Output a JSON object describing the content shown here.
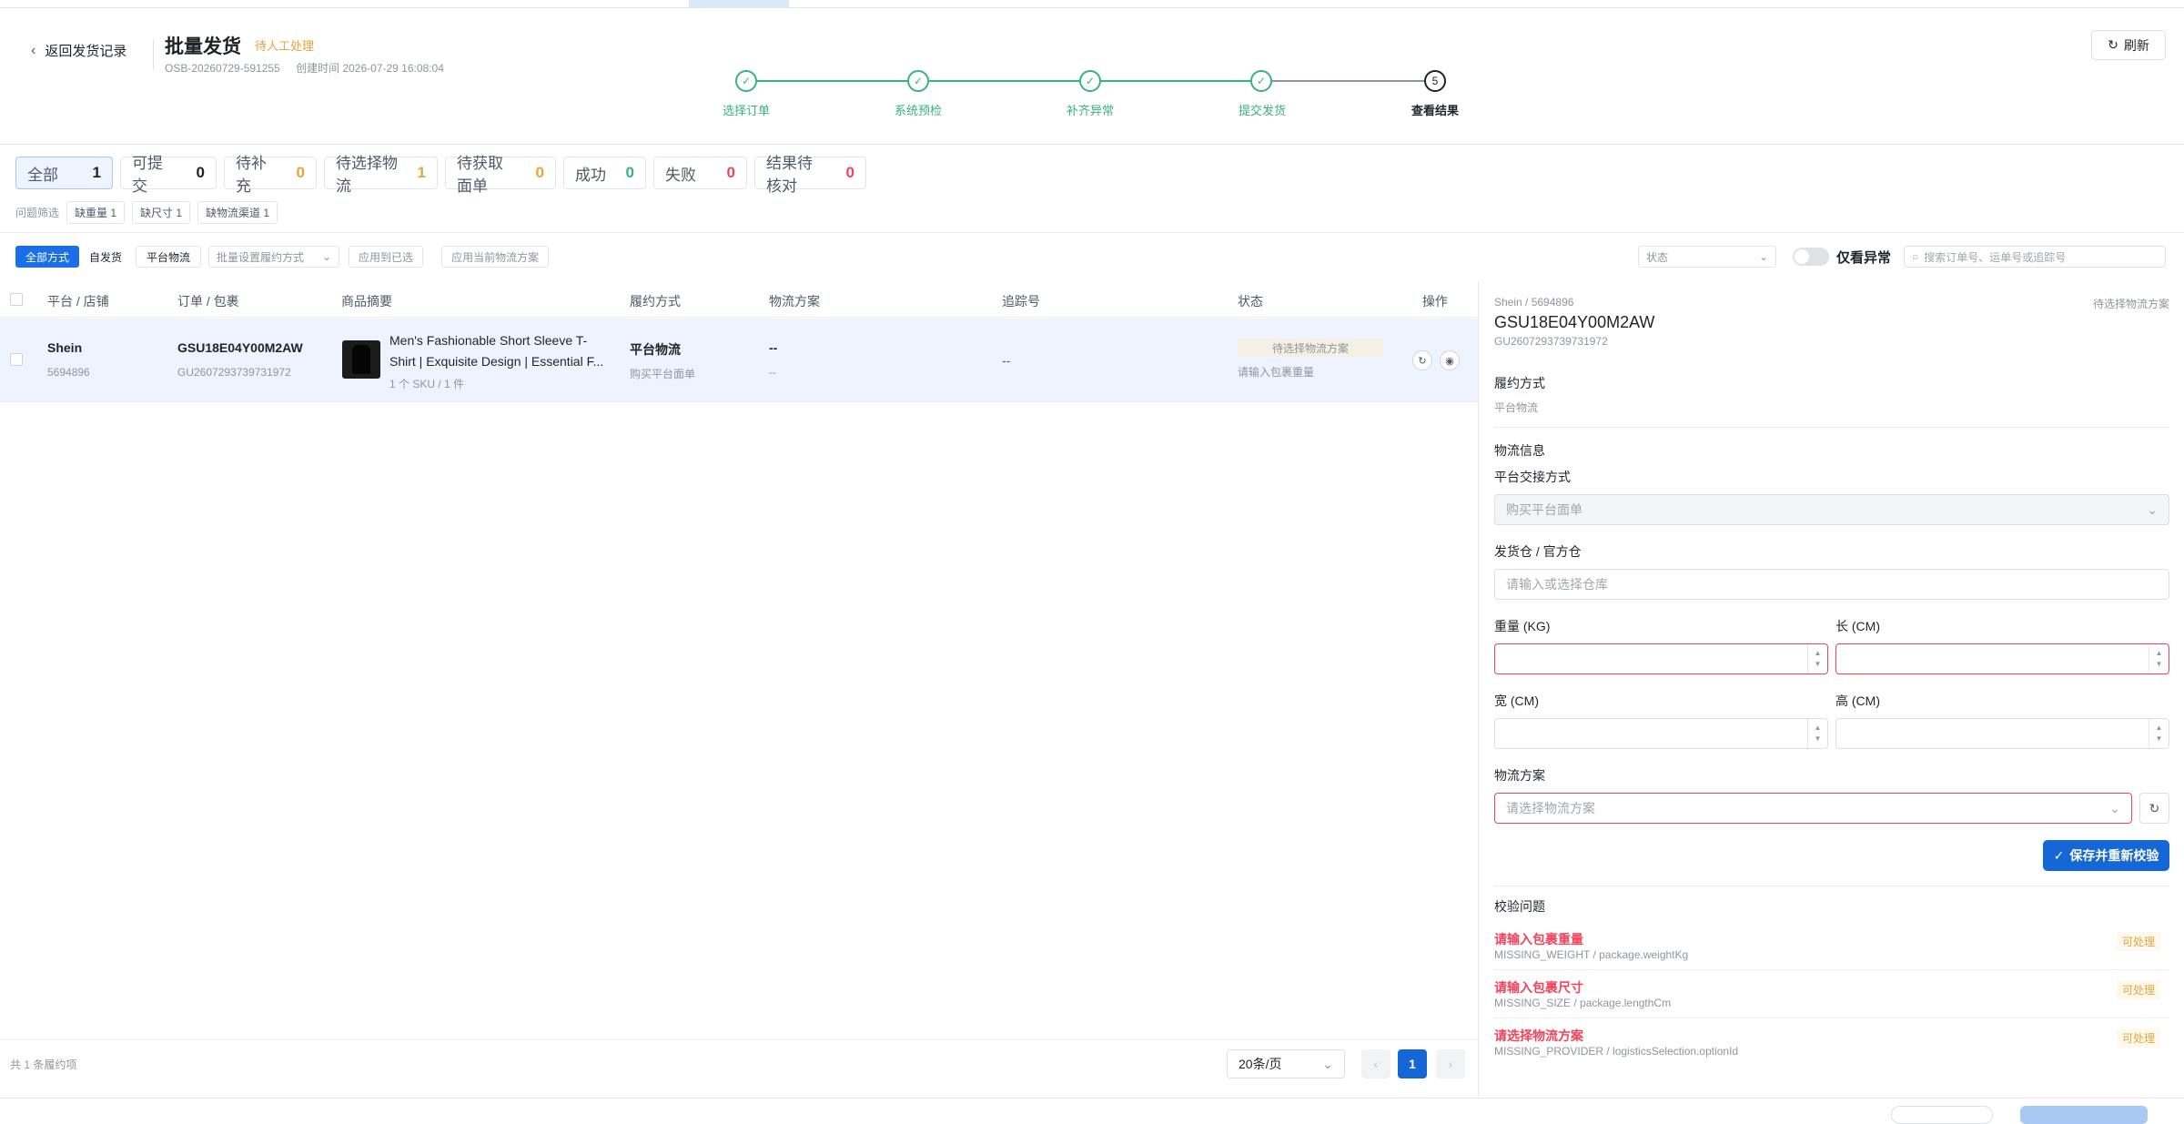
{
  "header": {
    "back_label": "返回发货记录",
    "title": "批量发货",
    "status_tag": "待人工处理",
    "batch_no": "OSB-20260729-591255",
    "created": "创建时间 2026-07-29 16:08:04",
    "refresh_label": "刷新"
  },
  "steps": [
    {
      "label": "选择订单",
      "state": "done",
      "mark": "✓"
    },
    {
      "label": "系统预检",
      "state": "done",
      "mark": "✓"
    },
    {
      "label": "补齐异常",
      "state": "done",
      "mark": "✓"
    },
    {
      "label": "提交发货",
      "state": "done",
      "mark": "✓"
    },
    {
      "label": "查看结果",
      "state": "current",
      "mark": "5"
    }
  ],
  "filters": [
    {
      "label": "全部",
      "count": "1",
      "color": "#1f2329"
    },
    {
      "label": "可提交",
      "count": "0",
      "color": "#1f2329"
    },
    {
      "label": "待补充",
      "count": "0",
      "color": "#e8a33d"
    },
    {
      "label": "待选择物流",
      "count": "1",
      "color": "#e8a33d"
    },
    {
      "label": "待获取面单",
      "count": "0",
      "color": "#e8a33d"
    },
    {
      "label": "成功",
      "count": "0",
      "color": "#36b37e"
    },
    {
      "label": "失败",
      "count": "0",
      "color": "#f0445a"
    },
    {
      "label": "结果待核对",
      "count": "0",
      "color": "#f0445a"
    }
  ],
  "issue_filter": {
    "label": "问题筛选",
    "chips": [
      "缺重量 1",
      "缺尺寸 1",
      "缺物流渠道 1"
    ]
  },
  "toolbar": {
    "mode_all": "全部方式",
    "mode_self": "自发货",
    "mode_platform": "平台物流",
    "batch_select": "批量设置履约方式",
    "apply_selected": "应用到已选",
    "apply_current": "应用当前物流方案",
    "status_select": "状态",
    "only_error": "仅看异常",
    "search_placeholder": "搜索订单号、运单号或追踪号"
  },
  "table": {
    "headers": [
      "平台 / 店铺",
      "订单 / 包裹",
      "商品摘要",
      "履约方式",
      "物流方案",
      "追踪号",
      "状态",
      "操作"
    ],
    "rows": [
      {
        "platform": "Shein",
        "shop": "5694896",
        "order": "GSU18E04Y00M2AW",
        "package": "GU2607293739731972",
        "product_title": "Men's Fashionable Short Sleeve T-Shirt | Exquisite Design | Essential F...",
        "product_line1": "Men's Fashionable Short Sleeve T-",
        "product_line2": "Shirt | Exquisite Design | Essential F...",
        "product_meta": "1 个 SKU / 1 件",
        "method": "平台物流",
        "method_sub": "购买平台面单",
        "logistics": "--",
        "logistics_sub": "--",
        "tracking": "--",
        "status": "待选择物流方案",
        "status_sub": "请输入包裹重量"
      }
    ]
  },
  "footer": {
    "total": "共 1 条履约项",
    "page_size": "20条/页",
    "page": "1",
    "prev": "‹",
    "next": "›"
  },
  "panel": {
    "crumb": "Shein / 5694896",
    "status": "待选择物流方案",
    "order": "GSU18E04Y00M2AW",
    "package": "GU2607293739731972",
    "method_label": "履约方式",
    "method_value": "平台物流",
    "logistics_title": "物流信息",
    "handover_label": "平台交接方式",
    "handover_value": "购买平台面单",
    "warehouse_label": "发货仓 / 官方仓",
    "warehouse_placeholder": "请输入或选择仓库",
    "weight_label": "重量 (KG)",
    "length_label": "长 (CM)",
    "width_label": "宽 (CM)",
    "height_label": "高 (CM)",
    "plan_label": "物流方案",
    "plan_placeholder": "请选择物流方案",
    "save_label": "保存并重新校验",
    "issues_title": "校验问题",
    "issues": [
      {
        "title": "请输入包裹重量",
        "code": "MISSING_WEIGHT / package.weightKg",
        "tag": "可处理"
      },
      {
        "title": "请输入包裹尺寸",
        "code": "MISSING_SIZE / package.lengthCm",
        "tag": "可处理"
      },
      {
        "title": "请选择物流方案",
        "code": "MISSING_PROVIDER / logisticsSelection.optionId",
        "tag": "可处理"
      }
    ]
  },
  "colors": {
    "primary": "#1a6fe8",
    "success": "#36b37e",
    "warning": "#e8a33d",
    "danger": "#f0445a"
  }
}
